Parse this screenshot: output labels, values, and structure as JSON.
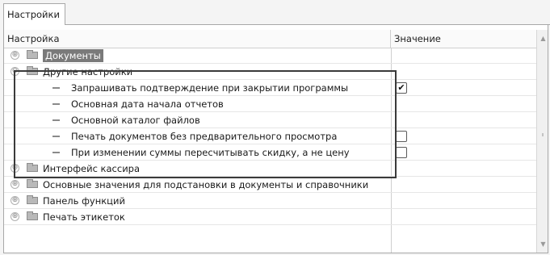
{
  "tab": {
    "label": "Настройки"
  },
  "grid": {
    "columns": {
      "setting": "Настройка",
      "value": "Значение"
    },
    "rows": [
      {
        "label": "Документы",
        "type": "folder",
        "expander": "⊕",
        "selected": true
      },
      {
        "label": "Другие настройки",
        "type": "folder",
        "expander": "⊖"
      },
      {
        "label": "Запрашивать подтверждение при закрытии программы",
        "type": "item",
        "checkbox": true,
        "checked": true,
        "mark": "✔"
      },
      {
        "label": "Основная дата начала отчетов",
        "type": "item"
      },
      {
        "label": "Основной каталог файлов",
        "type": "item"
      },
      {
        "label": "Печать документов без предварительного просмотра",
        "type": "item",
        "checkbox": true,
        "checked": false
      },
      {
        "label": "При изменении суммы пересчитывать скидку, а не цену",
        "type": "item",
        "checkbox": true,
        "checked": false
      },
      {
        "label": "Интерфейс кассира",
        "type": "folder",
        "expander": "⊕"
      },
      {
        "label": "Основные значения для подстановки в документы и справочники",
        "type": "folder",
        "expander": "⊕"
      },
      {
        "label": "Панель функций",
        "type": "folder",
        "expander": "⊕"
      },
      {
        "label": "Печать этикеток",
        "type": "folder",
        "expander": "⊕"
      }
    ]
  },
  "scrollbar": {
    "up": "▲",
    "down": "▼"
  },
  "colors": {
    "highlight": "#3a3a3a",
    "selected_bg": "#7a7a7a"
  },
  "icons": {
    "folder": "folder-icon",
    "item": "setting-dash-icon",
    "expand": "expand-icon",
    "collapse": "collapse-icon"
  }
}
